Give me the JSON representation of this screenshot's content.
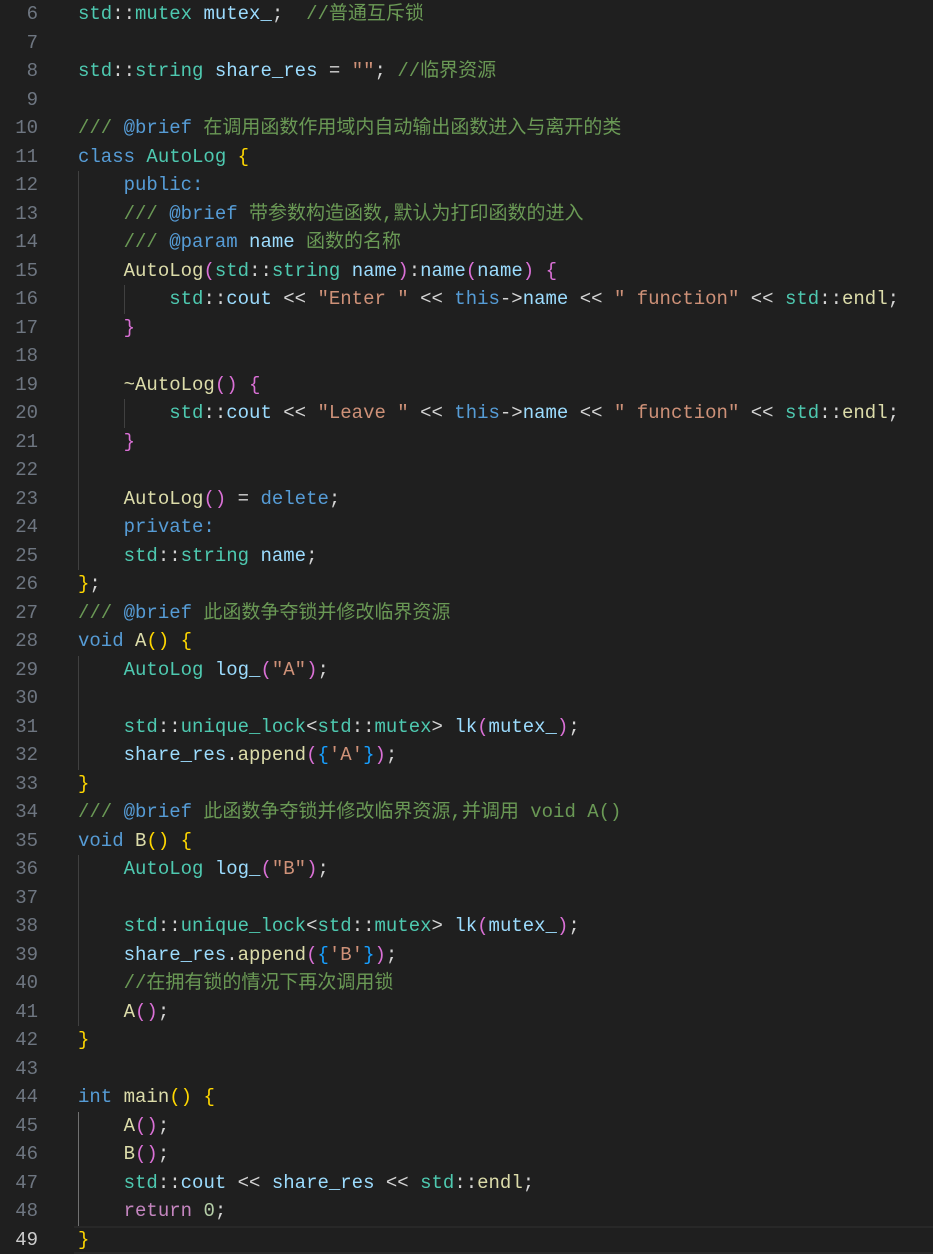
{
  "editor": {
    "active_line": 49,
    "lines": [
      {
        "n": 6,
        "t": [
          [
            "std",
            "ns"
          ],
          [
            "::",
            "op"
          ],
          [
            "mutex",
            "ns"
          ],
          [
            " ",
            "op"
          ],
          [
            "mutex_",
            "var"
          ],
          [
            ";  ",
            "op"
          ],
          [
            "//普通互斥锁",
            "cm"
          ]
        ]
      },
      {
        "n": 7,
        "t": []
      },
      {
        "n": 8,
        "t": [
          [
            "std",
            "ns"
          ],
          [
            "::",
            "op"
          ],
          [
            "string",
            "ns"
          ],
          [
            " ",
            "op"
          ],
          [
            "share_res",
            "var"
          ],
          [
            " = ",
            "op"
          ],
          [
            "\"\"",
            "str"
          ],
          [
            "; ",
            "op"
          ],
          [
            "//临界资源",
            "cm"
          ]
        ]
      },
      {
        "n": 9,
        "t": []
      },
      {
        "n": 10,
        "t": [
          [
            "/// ",
            "cm"
          ],
          [
            "@brief",
            "kw"
          ],
          [
            " 在调用函数作用域内自动输出函数进入与离开的类",
            "cm"
          ]
        ]
      },
      {
        "n": 11,
        "t": [
          [
            "class",
            "kw"
          ],
          [
            " ",
            "op"
          ],
          [
            "AutoLog",
            "ns"
          ],
          [
            " ",
            "op"
          ],
          [
            "{",
            "b1"
          ]
        ]
      },
      {
        "n": 12,
        "t": [
          [
            "    ",
            "op"
          ],
          [
            "public:",
            "kw"
          ]
        ]
      },
      {
        "n": 13,
        "t": [
          [
            "    ",
            "op"
          ],
          [
            "/// ",
            "cm"
          ],
          [
            "@brief",
            "kw"
          ],
          [
            " 带参数构造函数,默认为打印函数的进入",
            "cm"
          ]
        ]
      },
      {
        "n": 14,
        "t": [
          [
            "    ",
            "op"
          ],
          [
            "/// ",
            "cm"
          ],
          [
            "@param",
            "kw"
          ],
          [
            " ",
            "cm"
          ],
          [
            "name",
            "var"
          ],
          [
            " 函数的名称",
            "cm"
          ]
        ]
      },
      {
        "n": 15,
        "t": [
          [
            "    ",
            "op"
          ],
          [
            "AutoLog",
            "fn"
          ],
          [
            "(",
            "b2"
          ],
          [
            "std",
            "ns"
          ],
          [
            "::",
            "op"
          ],
          [
            "string",
            "ns"
          ],
          [
            " ",
            "op"
          ],
          [
            "name",
            "var"
          ],
          [
            ")",
            "b2"
          ],
          [
            ":",
            "op"
          ],
          [
            "name",
            "var"
          ],
          [
            "(",
            "b2"
          ],
          [
            "name",
            "var"
          ],
          [
            ")",
            "b2"
          ],
          [
            " ",
            "op"
          ],
          [
            "{",
            "b2"
          ]
        ]
      },
      {
        "n": 16,
        "t": [
          [
            "        ",
            "op"
          ],
          [
            "std",
            "ns"
          ],
          [
            "::",
            "op"
          ],
          [
            "cout",
            "var"
          ],
          [
            " << ",
            "op"
          ],
          [
            "\"Enter \"",
            "str"
          ],
          [
            " << ",
            "op"
          ],
          [
            "this",
            "kw"
          ],
          [
            "->",
            "op"
          ],
          [
            "name",
            "var"
          ],
          [
            " << ",
            "op"
          ],
          [
            "\" function\"",
            "str"
          ],
          [
            " << ",
            "op"
          ],
          [
            "std",
            "ns"
          ],
          [
            "::",
            "op"
          ],
          [
            "endl",
            "fn"
          ],
          [
            ";",
            "op"
          ]
        ]
      },
      {
        "n": 17,
        "t": [
          [
            "    ",
            "op"
          ],
          [
            "}",
            "b2"
          ]
        ]
      },
      {
        "n": 18,
        "t": []
      },
      {
        "n": 19,
        "t": [
          [
            "    ",
            "op"
          ],
          [
            "~AutoLog",
            "fn"
          ],
          [
            "()",
            "b2"
          ],
          [
            " ",
            "op"
          ],
          [
            "{",
            "b2"
          ]
        ]
      },
      {
        "n": 20,
        "t": [
          [
            "        ",
            "op"
          ],
          [
            "std",
            "ns"
          ],
          [
            "::",
            "op"
          ],
          [
            "cout",
            "var"
          ],
          [
            " << ",
            "op"
          ],
          [
            "\"Leave \"",
            "str"
          ],
          [
            " << ",
            "op"
          ],
          [
            "this",
            "kw"
          ],
          [
            "->",
            "op"
          ],
          [
            "name",
            "var"
          ],
          [
            " << ",
            "op"
          ],
          [
            "\" function\"",
            "str"
          ],
          [
            " << ",
            "op"
          ],
          [
            "std",
            "ns"
          ],
          [
            "::",
            "op"
          ],
          [
            "endl",
            "fn"
          ],
          [
            ";",
            "op"
          ]
        ]
      },
      {
        "n": 21,
        "t": [
          [
            "    ",
            "op"
          ],
          [
            "}",
            "b2"
          ]
        ]
      },
      {
        "n": 22,
        "t": []
      },
      {
        "n": 23,
        "t": [
          [
            "    ",
            "op"
          ],
          [
            "AutoLog",
            "fn"
          ],
          [
            "()",
            "b2"
          ],
          [
            " = ",
            "op"
          ],
          [
            "delete",
            "kw"
          ],
          [
            ";",
            "op"
          ]
        ]
      },
      {
        "n": 24,
        "t": [
          [
            "    ",
            "op"
          ],
          [
            "private:",
            "kw"
          ]
        ]
      },
      {
        "n": 25,
        "t": [
          [
            "    ",
            "op"
          ],
          [
            "std",
            "ns"
          ],
          [
            "::",
            "op"
          ],
          [
            "string",
            "ns"
          ],
          [
            " ",
            "op"
          ],
          [
            "name",
            "var"
          ],
          [
            ";",
            "op"
          ]
        ]
      },
      {
        "n": 26,
        "t": [
          [
            "}",
            "b1"
          ],
          [
            ";",
            "op"
          ]
        ]
      },
      {
        "n": 27,
        "t": [
          [
            "/// ",
            "cm"
          ],
          [
            "@brief",
            "kw"
          ],
          [
            " 此函数争夺锁并修改临界资源",
            "cm"
          ]
        ]
      },
      {
        "n": 28,
        "t": [
          [
            "void",
            "kw"
          ],
          [
            " ",
            "op"
          ],
          [
            "A",
            "fn"
          ],
          [
            "()",
            "b1"
          ],
          [
            " ",
            "op"
          ],
          [
            "{",
            "b1"
          ]
        ]
      },
      {
        "n": 29,
        "t": [
          [
            "    ",
            "op"
          ],
          [
            "AutoLog",
            "ns"
          ],
          [
            " ",
            "op"
          ],
          [
            "log_",
            "var"
          ],
          [
            "(",
            "b2"
          ],
          [
            "\"A\"",
            "str"
          ],
          [
            ")",
            "b2"
          ],
          [
            ";",
            "op"
          ]
        ]
      },
      {
        "n": 30,
        "t": []
      },
      {
        "n": 31,
        "t": [
          [
            "    ",
            "op"
          ],
          [
            "std",
            "ns"
          ],
          [
            "::",
            "op"
          ],
          [
            "unique_lock",
            "ns"
          ],
          [
            "<",
            "op"
          ],
          [
            "std",
            "ns"
          ],
          [
            "::",
            "op"
          ],
          [
            "mutex",
            "ns"
          ],
          [
            "> ",
            "op"
          ],
          [
            "lk",
            "var"
          ],
          [
            "(",
            "b2"
          ],
          [
            "mutex_",
            "var"
          ],
          [
            ")",
            "b2"
          ],
          [
            ";",
            "op"
          ]
        ]
      },
      {
        "n": 32,
        "t": [
          [
            "    ",
            "op"
          ],
          [
            "share_res",
            "var"
          ],
          [
            ".",
            "op"
          ],
          [
            "append",
            "fn"
          ],
          [
            "(",
            "b2"
          ],
          [
            "{",
            "b3"
          ],
          [
            "'A'",
            "str"
          ],
          [
            "}",
            "b3"
          ],
          [
            ")",
            "b2"
          ],
          [
            ";",
            "op"
          ]
        ]
      },
      {
        "n": 33,
        "t": [
          [
            "}",
            "b1"
          ]
        ]
      },
      {
        "n": 34,
        "t": [
          [
            "/// ",
            "cm"
          ],
          [
            "@brief",
            "kw"
          ],
          [
            " 此函数争夺锁并修改临界资源,并调用 void A()",
            "cm"
          ]
        ]
      },
      {
        "n": 35,
        "t": [
          [
            "void",
            "kw"
          ],
          [
            " ",
            "op"
          ],
          [
            "B",
            "fn"
          ],
          [
            "()",
            "b1"
          ],
          [
            " ",
            "op"
          ],
          [
            "{",
            "b1"
          ]
        ]
      },
      {
        "n": 36,
        "t": [
          [
            "    ",
            "op"
          ],
          [
            "AutoLog",
            "ns"
          ],
          [
            " ",
            "op"
          ],
          [
            "log_",
            "var"
          ],
          [
            "(",
            "b2"
          ],
          [
            "\"B\"",
            "str"
          ],
          [
            ")",
            "b2"
          ],
          [
            ";",
            "op"
          ]
        ]
      },
      {
        "n": 37,
        "t": []
      },
      {
        "n": 38,
        "t": [
          [
            "    ",
            "op"
          ],
          [
            "std",
            "ns"
          ],
          [
            "::",
            "op"
          ],
          [
            "unique_lock",
            "ns"
          ],
          [
            "<",
            "op"
          ],
          [
            "std",
            "ns"
          ],
          [
            "::",
            "op"
          ],
          [
            "mutex",
            "ns"
          ],
          [
            "> ",
            "op"
          ],
          [
            "lk",
            "var"
          ],
          [
            "(",
            "b2"
          ],
          [
            "mutex_",
            "var"
          ],
          [
            ")",
            "b2"
          ],
          [
            ";",
            "op"
          ]
        ]
      },
      {
        "n": 39,
        "t": [
          [
            "    ",
            "op"
          ],
          [
            "share_res",
            "var"
          ],
          [
            ".",
            "op"
          ],
          [
            "append",
            "fn"
          ],
          [
            "(",
            "b2"
          ],
          [
            "{",
            "b3"
          ],
          [
            "'B'",
            "str"
          ],
          [
            "}",
            "b3"
          ],
          [
            ")",
            "b2"
          ],
          [
            ";",
            "op"
          ]
        ]
      },
      {
        "n": 40,
        "t": [
          [
            "    ",
            "op"
          ],
          [
            "//在拥有锁的情况下再次调用锁",
            "cm"
          ]
        ]
      },
      {
        "n": 41,
        "t": [
          [
            "    ",
            "op"
          ],
          [
            "A",
            "fn"
          ],
          [
            "()",
            "b2"
          ],
          [
            ";",
            "op"
          ]
        ]
      },
      {
        "n": 42,
        "t": [
          [
            "}",
            "b1"
          ]
        ]
      },
      {
        "n": 43,
        "t": []
      },
      {
        "n": 44,
        "t": [
          [
            "int",
            "kw"
          ],
          [
            " ",
            "op"
          ],
          [
            "main",
            "fn"
          ],
          [
            "()",
            "b1"
          ],
          [
            " ",
            "op"
          ],
          [
            "{",
            "b1"
          ]
        ]
      },
      {
        "n": 45,
        "t": [
          [
            "    ",
            "op"
          ],
          [
            "A",
            "fn"
          ],
          [
            "()",
            "b2"
          ],
          [
            ";",
            "op"
          ]
        ]
      },
      {
        "n": 46,
        "t": [
          [
            "    ",
            "op"
          ],
          [
            "B",
            "fn"
          ],
          [
            "()",
            "b2"
          ],
          [
            ";",
            "op"
          ]
        ]
      },
      {
        "n": 47,
        "t": [
          [
            "    ",
            "op"
          ],
          [
            "std",
            "ns"
          ],
          [
            "::",
            "op"
          ],
          [
            "cout",
            "var"
          ],
          [
            " << ",
            "op"
          ],
          [
            "share_res",
            "var"
          ],
          [
            " << ",
            "op"
          ],
          [
            "std",
            "ns"
          ],
          [
            "::",
            "op"
          ],
          [
            "endl",
            "fn"
          ],
          [
            ";",
            "op"
          ]
        ]
      },
      {
        "n": 48,
        "t": [
          [
            "    ",
            "op"
          ],
          [
            "return",
            "ctl"
          ],
          [
            " ",
            "op"
          ],
          [
            "0",
            "num"
          ],
          [
            ";",
            "op"
          ]
        ]
      },
      {
        "n": 49,
        "t": [
          [
            "}",
            "b1"
          ]
        ]
      }
    ]
  }
}
